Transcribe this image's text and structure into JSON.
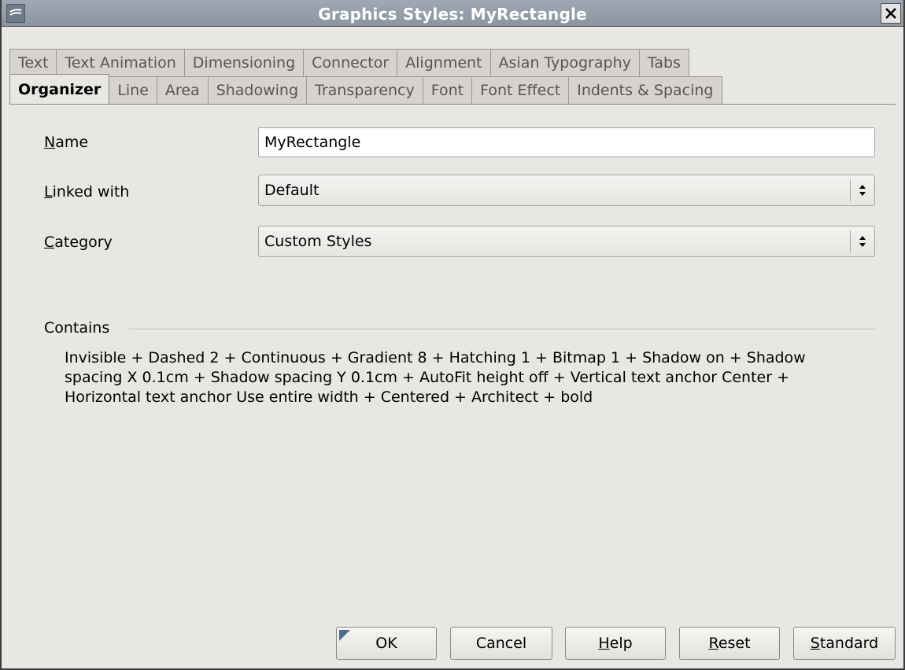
{
  "window": {
    "title": "Graphics Styles: MyRectangle"
  },
  "tabs": {
    "back_row": [
      "Text",
      "Text Animation",
      "Dimensioning",
      "Connector",
      "Alignment",
      "Asian Typography",
      "Tabs"
    ],
    "front_row": [
      "Organizer",
      "Line",
      "Area",
      "Shadowing",
      "Transparency",
      "Font",
      "Font Effect",
      "Indents & Spacing"
    ],
    "active": "Organizer"
  },
  "form": {
    "name": {
      "label_mnemonic": "N",
      "label_rest": "ame",
      "value": "MyRectangle"
    },
    "linked_with": {
      "label_mnemonic": "L",
      "label_rest": "inked with",
      "value": "Default"
    },
    "category": {
      "label_mnemonic": "C",
      "label_rest": "ategory",
      "value": "Custom Styles"
    }
  },
  "contains": {
    "label": "Contains",
    "text": "Invisible + Dashed 2 + Continuous + Gradient 8 + Hatching 1 + Bitmap 1 + Shadow on + Shadow spacing X 0.1cm + Shadow spacing Y 0.1cm + AutoFit height off + Vertical text anchor Center + Horizontal text anchor Use entire width + Centered + Architect + bold"
  },
  "buttons": {
    "ok": "OK",
    "cancel": "Cancel",
    "help": {
      "mnemonic": "H",
      "rest": "elp"
    },
    "reset": {
      "mnemonic": "R",
      "rest": "eset"
    },
    "standard": {
      "mnemonic": "S",
      "rest": "tandard"
    }
  },
  "icons": {
    "window": "app-menu-icon",
    "close": "close-icon",
    "spin": "spin-updown-icon"
  }
}
